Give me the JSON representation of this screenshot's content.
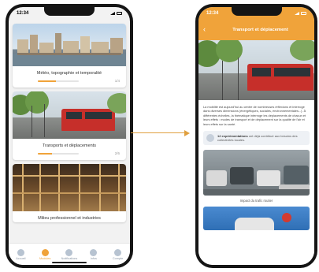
{
  "left_phone": {
    "status_time": "12:34",
    "cards": [
      {
        "title": "Météo, topographie et temporalité",
        "count": "1/4",
        "progress": 0.45
      },
      {
        "title": "Transports et déplacements",
        "count": "2/6",
        "progress": 0.35
      },
      {
        "title": "Milieu professionnel et industries",
        "count": "",
        "progress": 0
      }
    ],
    "tabs": [
      {
        "label": "Accueil",
        "icon": "home-icon",
        "active": false
      },
      {
        "label": "Modules",
        "icon": "modules-icon",
        "active": true
      },
      {
        "label": "Notifications",
        "icon": "bell-icon",
        "active": false
      },
      {
        "label": "Infos",
        "icon": "info-icon",
        "active": false
      },
      {
        "label": "Compte",
        "icon": "user-icon",
        "active": false
      }
    ]
  },
  "right_phone": {
    "status_time": "12:34",
    "title": "Transport et déplacement",
    "paragraph": "La mobilité est aujourd'hui au centre de nombreuses réflexions et interroge dans diverses dimensions (énergétiques, sociales, environnementales...). À différentes échelles, la thématique interroge les déplacements de chacun et leurs effets : modes de transport et de déplacement sur la qualité de l'air et leurs effets sur la santé.",
    "stat": {
      "highlight": "12 expérimentations",
      "text": "ont déjà contribué aux besoins des collectivités locales."
    },
    "media_caption": "Impact du trafic routier"
  },
  "colors": {
    "accent": "#f0a33a",
    "tab_inactive": "#b7c3d1",
    "tram_red": "#c62f2a"
  }
}
